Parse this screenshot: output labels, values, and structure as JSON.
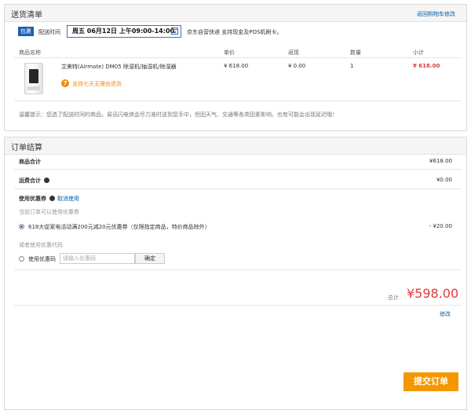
{
  "delivery": {
    "title": "送货清单",
    "back_link": "返回购物车修改",
    "badge": "包裹",
    "time_label": "配送时间",
    "date_value": "周五 06月12日 上午09:00-14:00",
    "shipping_note": "京东自营快递 支持现金及POS机刷卡。",
    "table_headers": [
      "商品名称",
      "单价",
      "返现",
      "数量",
      "小计"
    ],
    "item": {
      "name": "艾美特(Airmate) DM05 除湿机/抽湿机/除湿器",
      "price": "¥ 618.00",
      "cashback": "¥ 0.00",
      "qty": "1",
      "subtotal": "¥ 618.00",
      "return_icon_text": "7",
      "return_policy": "支持七天无理由退货"
    },
    "tip": "温馨提示：您选了配送时间的商品，易迅闪电侠会尽力准时送到您手中，但因天气、交通等各类因素影响，也有可能会出现延迟哦！"
  },
  "settlement": {
    "title": "订单结算",
    "goods_total_label": "商品合计",
    "goods_total_value": "¥618.00",
    "freight_label": "运费合计",
    "freight_value": "¥0.00",
    "coupon_label": "使用优惠券",
    "cancel_coupon": "取消使用",
    "coupon_hint": "当前订单可以使用优惠券",
    "coupon_option": "618大促家电活动满200元减20元优惠券（仅限指定商品，特价商品除外）",
    "coupon_discount": "- ¥20.00",
    "or_code_label": "或者使用优惠代码",
    "use_code_label": "使用优惠码",
    "code_placeholder": "请输入优惠码",
    "confirm_label": "确定",
    "total_label": "总计",
    "total_value": "¥598.00",
    "modify_link": "修改",
    "submit_label": "提交订单"
  },
  "colors": {
    "accent_blue": "#1a5fb4",
    "price_red": "#e4393c",
    "submit_orange": "#f39800",
    "link_blue": "#005ea7"
  }
}
